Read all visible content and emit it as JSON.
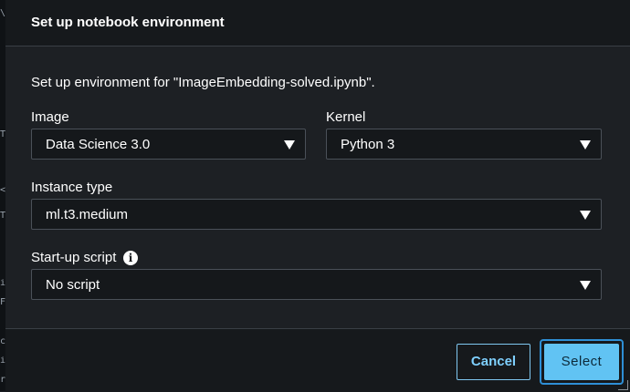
{
  "backdrop": {
    "glyphs": [
      "\\",
      "T",
      "<",
      "T",
      "i",
      "F",
      "c",
      "i",
      "r"
    ]
  },
  "dialog": {
    "title": "Set up notebook environment",
    "description": "Set up environment for \"ImageEmbedding-solved.ipynb\".",
    "fields": {
      "image": {
        "label": "Image",
        "value": "Data Science 3.0"
      },
      "kernel": {
        "label": "Kernel",
        "value": "Python 3"
      },
      "instance_type": {
        "label": "Instance type",
        "value": "ml.t3.medium"
      },
      "startup_script": {
        "label": "Start-up script",
        "value": "No script",
        "info_icon": "info-icon"
      }
    },
    "buttons": {
      "cancel": "Cancel",
      "select": "Select"
    }
  },
  "colors": {
    "accent": "#61c3f3",
    "cancel_text": "#7fd0ff",
    "dialog_bg": "#1d2024",
    "header_bg": "#16191c"
  }
}
